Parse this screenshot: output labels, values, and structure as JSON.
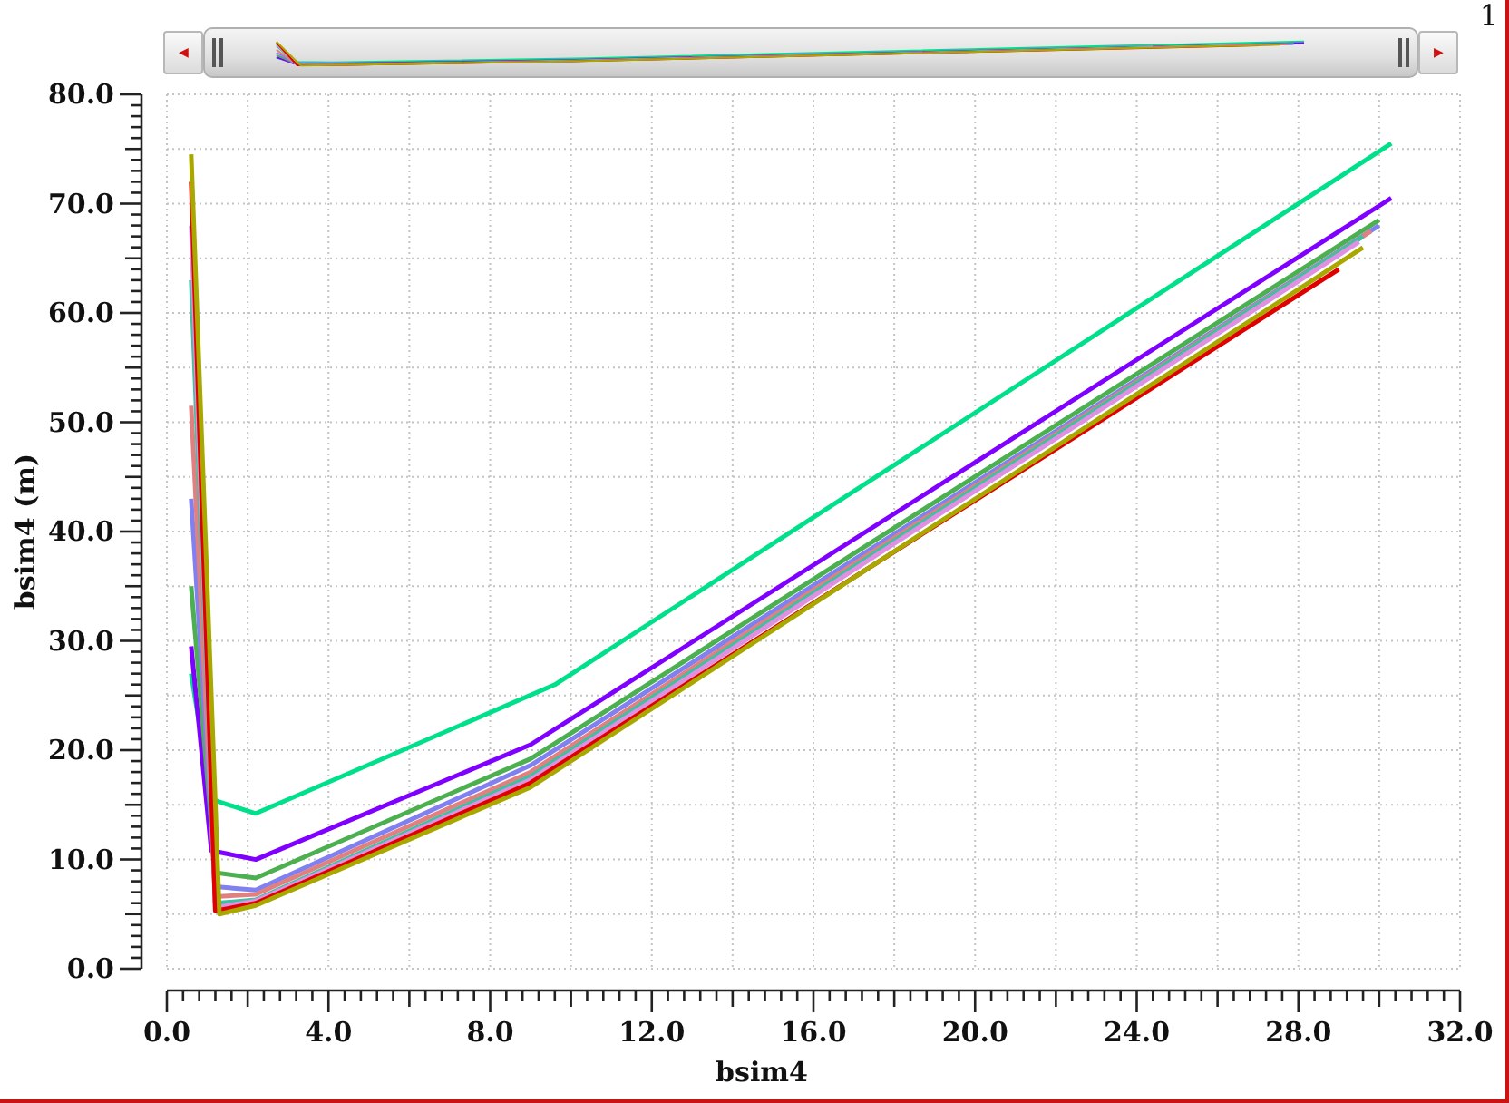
{
  "corner_label": "1",
  "overview": {
    "left_arrow": "◀",
    "right_arrow": "▶"
  },
  "plot": {
    "chart_data": {
      "type": "line",
      "grid": true,
      "xlabel": "bsim4",
      "ylabel": "bsim4 (m)",
      "xlim": [
        0,
        32
      ],
      "ylim": [
        0,
        80
      ],
      "xticks": [
        {
          "value": 0,
          "label": "0.0"
        },
        {
          "value": 4,
          "label": "4.0"
        },
        {
          "value": 8,
          "label": "8.0"
        },
        {
          "value": 12,
          "label": "12.0"
        },
        {
          "value": 16,
          "label": "16.0"
        },
        {
          "value": 20,
          "label": "20.0"
        },
        {
          "value": 24,
          "label": "24.0"
        },
        {
          "value": 28,
          "label": "28.0"
        },
        {
          "value": 32,
          "label": "32.0"
        }
      ],
      "yticks": [
        {
          "value": 0,
          "label": "0.0"
        },
        {
          "value": 10,
          "label": "10.0"
        },
        {
          "value": 20,
          "label": "20.0"
        },
        {
          "value": 30,
          "label": "30.0"
        },
        {
          "value": 40,
          "label": "40.0"
        },
        {
          "value": 50,
          "label": "50.0"
        },
        {
          "value": 60,
          "label": "60.0"
        },
        {
          "value": 70,
          "label": "70.0"
        },
        {
          "value": 80,
          "label": "80.0"
        }
      ],
      "series": [
        {
          "color": "#00e08a",
          "x": [
            0.6,
            1.1,
            2.2,
            9.6,
            30.3
          ],
          "values": [
            27,
            15.5,
            14.2,
            26,
            75.5
          ]
        },
        {
          "color": "#8000ff",
          "x": [
            0.6,
            1.1,
            2.2,
            9.0,
            30.3
          ],
          "values": [
            29.5,
            10.8,
            10,
            20.5,
            70.5
          ]
        },
        {
          "color": "#4caf50",
          "x": [
            0.6,
            1.2,
            2.2,
            9.0,
            30.0
          ],
          "values": [
            35,
            8.8,
            8.3,
            19.2,
            68.5
          ]
        },
        {
          "color": "#8080f0",
          "x": [
            0.6,
            1.2,
            2.2,
            9.0,
            30.0
          ],
          "values": [
            43,
            7.5,
            7.2,
            18.6,
            68
          ]
        },
        {
          "color": "#e08080",
          "x": [
            0.6,
            1.2,
            2.2,
            9.0,
            29.8
          ],
          "values": [
            51.5,
            6.6,
            6.8,
            18,
            67.5
          ]
        },
        {
          "color": "#40c0a0",
          "x": [
            0.6,
            1.2,
            2.2,
            9.0,
            29.6
          ],
          "values": [
            63,
            6,
            6.3,
            17.6,
            67
          ]
        },
        {
          "color": "#e090e0",
          "x": [
            0.6,
            1.2,
            2.2,
            9.0,
            29.5
          ],
          "values": [
            68,
            5.6,
            6.2,
            17.3,
            66.5
          ]
        },
        {
          "color": "#e00000",
          "x": [
            0.6,
            1.2,
            2.2,
            9.0,
            29.0
          ],
          "values": [
            72,
            5.3,
            6,
            17,
            64
          ]
        },
        {
          "color": "#a8a800",
          "x": [
            0.6,
            1.3,
            2.2,
            9.0,
            29.6
          ],
          "values": [
            74.5,
            5,
            5.8,
            16.6,
            66
          ]
        }
      ]
    }
  }
}
